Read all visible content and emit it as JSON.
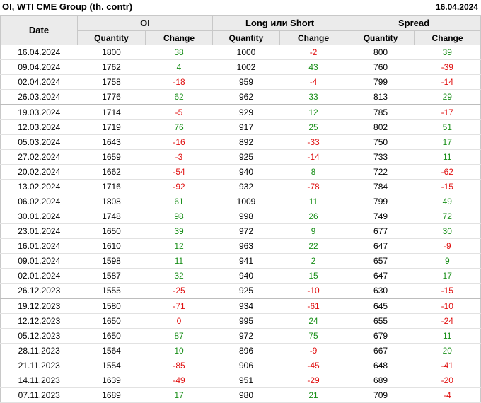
{
  "header": {
    "title": "OI, WTI CME Group (th. contr)",
    "date": "16.04.2024"
  },
  "columns": {
    "date": "Date",
    "groups": [
      "OI",
      "Long или Short",
      "Spread"
    ],
    "quantity": "Quantity",
    "change": "Change"
  },
  "rows": [
    {
      "date": "16.04.2024",
      "oi_q": "1800",
      "oi_c": "38",
      "ls_q": "1000",
      "ls_c": "-2",
      "sp_q": "800",
      "sp_c": "39"
    },
    {
      "date": "09.04.2024",
      "oi_q": "1762",
      "oi_c": "4",
      "ls_q": "1002",
      "ls_c": "43",
      "sp_q": "760",
      "sp_c": "-39"
    },
    {
      "date": "02.04.2024",
      "oi_q": "1758",
      "oi_c": "-18",
      "ls_q": "959",
      "ls_c": "-4",
      "sp_q": "799",
      "sp_c": "-14"
    },
    {
      "date": "26.03.2024",
      "oi_q": "1776",
      "oi_c": "62",
      "ls_q": "962",
      "ls_c": "33",
      "sp_q": "813",
      "sp_c": "29"
    },
    {
      "date": "19.03.2024",
      "oi_q": "1714",
      "oi_c": "-5",
      "ls_q": "929",
      "ls_c": "12",
      "sp_q": "785",
      "sp_c": "-17",
      "sep": true
    },
    {
      "date": "12.03.2024",
      "oi_q": "1719",
      "oi_c": "76",
      "ls_q": "917",
      "ls_c": "25",
      "sp_q": "802",
      "sp_c": "51"
    },
    {
      "date": "05.03.2024",
      "oi_q": "1643",
      "oi_c": "-16",
      "ls_q": "892",
      "ls_c": "-33",
      "sp_q": "750",
      "sp_c": "17"
    },
    {
      "date": "27.02.2024",
      "oi_q": "1659",
      "oi_c": "-3",
      "ls_q": "925",
      "ls_c": "-14",
      "sp_q": "733",
      "sp_c": "11"
    },
    {
      "date": "20.02.2024",
      "oi_q": "1662",
      "oi_c": "-54",
      "ls_q": "940",
      "ls_c": "8",
      "sp_q": "722",
      "sp_c": "-62"
    },
    {
      "date": "13.02.2024",
      "oi_q": "1716",
      "oi_c": "-92",
      "ls_q": "932",
      "ls_c": "-78",
      "sp_q": "784",
      "sp_c": "-15"
    },
    {
      "date": "06.02.2024",
      "oi_q": "1808",
      "oi_c": "61",
      "ls_q": "1009",
      "ls_c": "11",
      "sp_q": "799",
      "sp_c": "49"
    },
    {
      "date": "30.01.2024",
      "oi_q": "1748",
      "oi_c": "98",
      "ls_q": "998",
      "ls_c": "26",
      "sp_q": "749",
      "sp_c": "72"
    },
    {
      "date": "23.01.2024",
      "oi_q": "1650",
      "oi_c": "39",
      "ls_q": "972",
      "ls_c": "9",
      "sp_q": "677",
      "sp_c": "30"
    },
    {
      "date": "16.01.2024",
      "oi_q": "1610",
      "oi_c": "12",
      "ls_q": "963",
      "ls_c": "22",
      "sp_q": "647",
      "sp_c": "-9"
    },
    {
      "date": "09.01.2024",
      "oi_q": "1598",
      "oi_c": "11",
      "ls_q": "941",
      "ls_c": "2",
      "sp_q": "657",
      "sp_c": "9"
    },
    {
      "date": "02.01.2024",
      "oi_q": "1587",
      "oi_c": "32",
      "ls_q": "940",
      "ls_c": "15",
      "sp_q": "647",
      "sp_c": "17"
    },
    {
      "date": "26.12.2023",
      "oi_q": "1555",
      "oi_c": "-25",
      "ls_q": "925",
      "ls_c": "-10",
      "sp_q": "630",
      "sp_c": "-15"
    },
    {
      "date": "19.12.2023",
      "oi_q": "1580",
      "oi_c": "-71",
      "ls_q": "934",
      "ls_c": "-61",
      "sp_q": "645",
      "sp_c": "-10",
      "sep": true
    },
    {
      "date": "12.12.2023",
      "oi_q": "1650",
      "oi_c": "0",
      "ls_q": "995",
      "ls_c": "24",
      "sp_q": "655",
      "sp_c": "-24"
    },
    {
      "date": "05.12.2023",
      "oi_q": "1650",
      "oi_c": "87",
      "ls_q": "972",
      "ls_c": "75",
      "sp_q": "679",
      "sp_c": "11"
    },
    {
      "date": "28.11.2023",
      "oi_q": "1564",
      "oi_c": "10",
      "ls_q": "896",
      "ls_c": "-9",
      "sp_q": "667",
      "sp_c": "20"
    },
    {
      "date": "21.11.2023",
      "oi_q": "1554",
      "oi_c": "-85",
      "ls_q": "906",
      "ls_c": "-45",
      "sp_q": "648",
      "sp_c": "-41"
    },
    {
      "date": "14.11.2023",
      "oi_q": "1639",
      "oi_c": "-49",
      "ls_q": "951",
      "ls_c": "-29",
      "sp_q": "689",
      "sp_c": "-20"
    },
    {
      "date": "07.11.2023",
      "oi_q": "1689",
      "oi_c": "17",
      "ls_q": "980",
      "ls_c": "21",
      "sp_q": "709",
      "sp_c": "-4"
    }
  ],
  "colors": {
    "positive": "#1a8f1a",
    "negative": "#e01010",
    "header_bg": "#ebebeb"
  }
}
